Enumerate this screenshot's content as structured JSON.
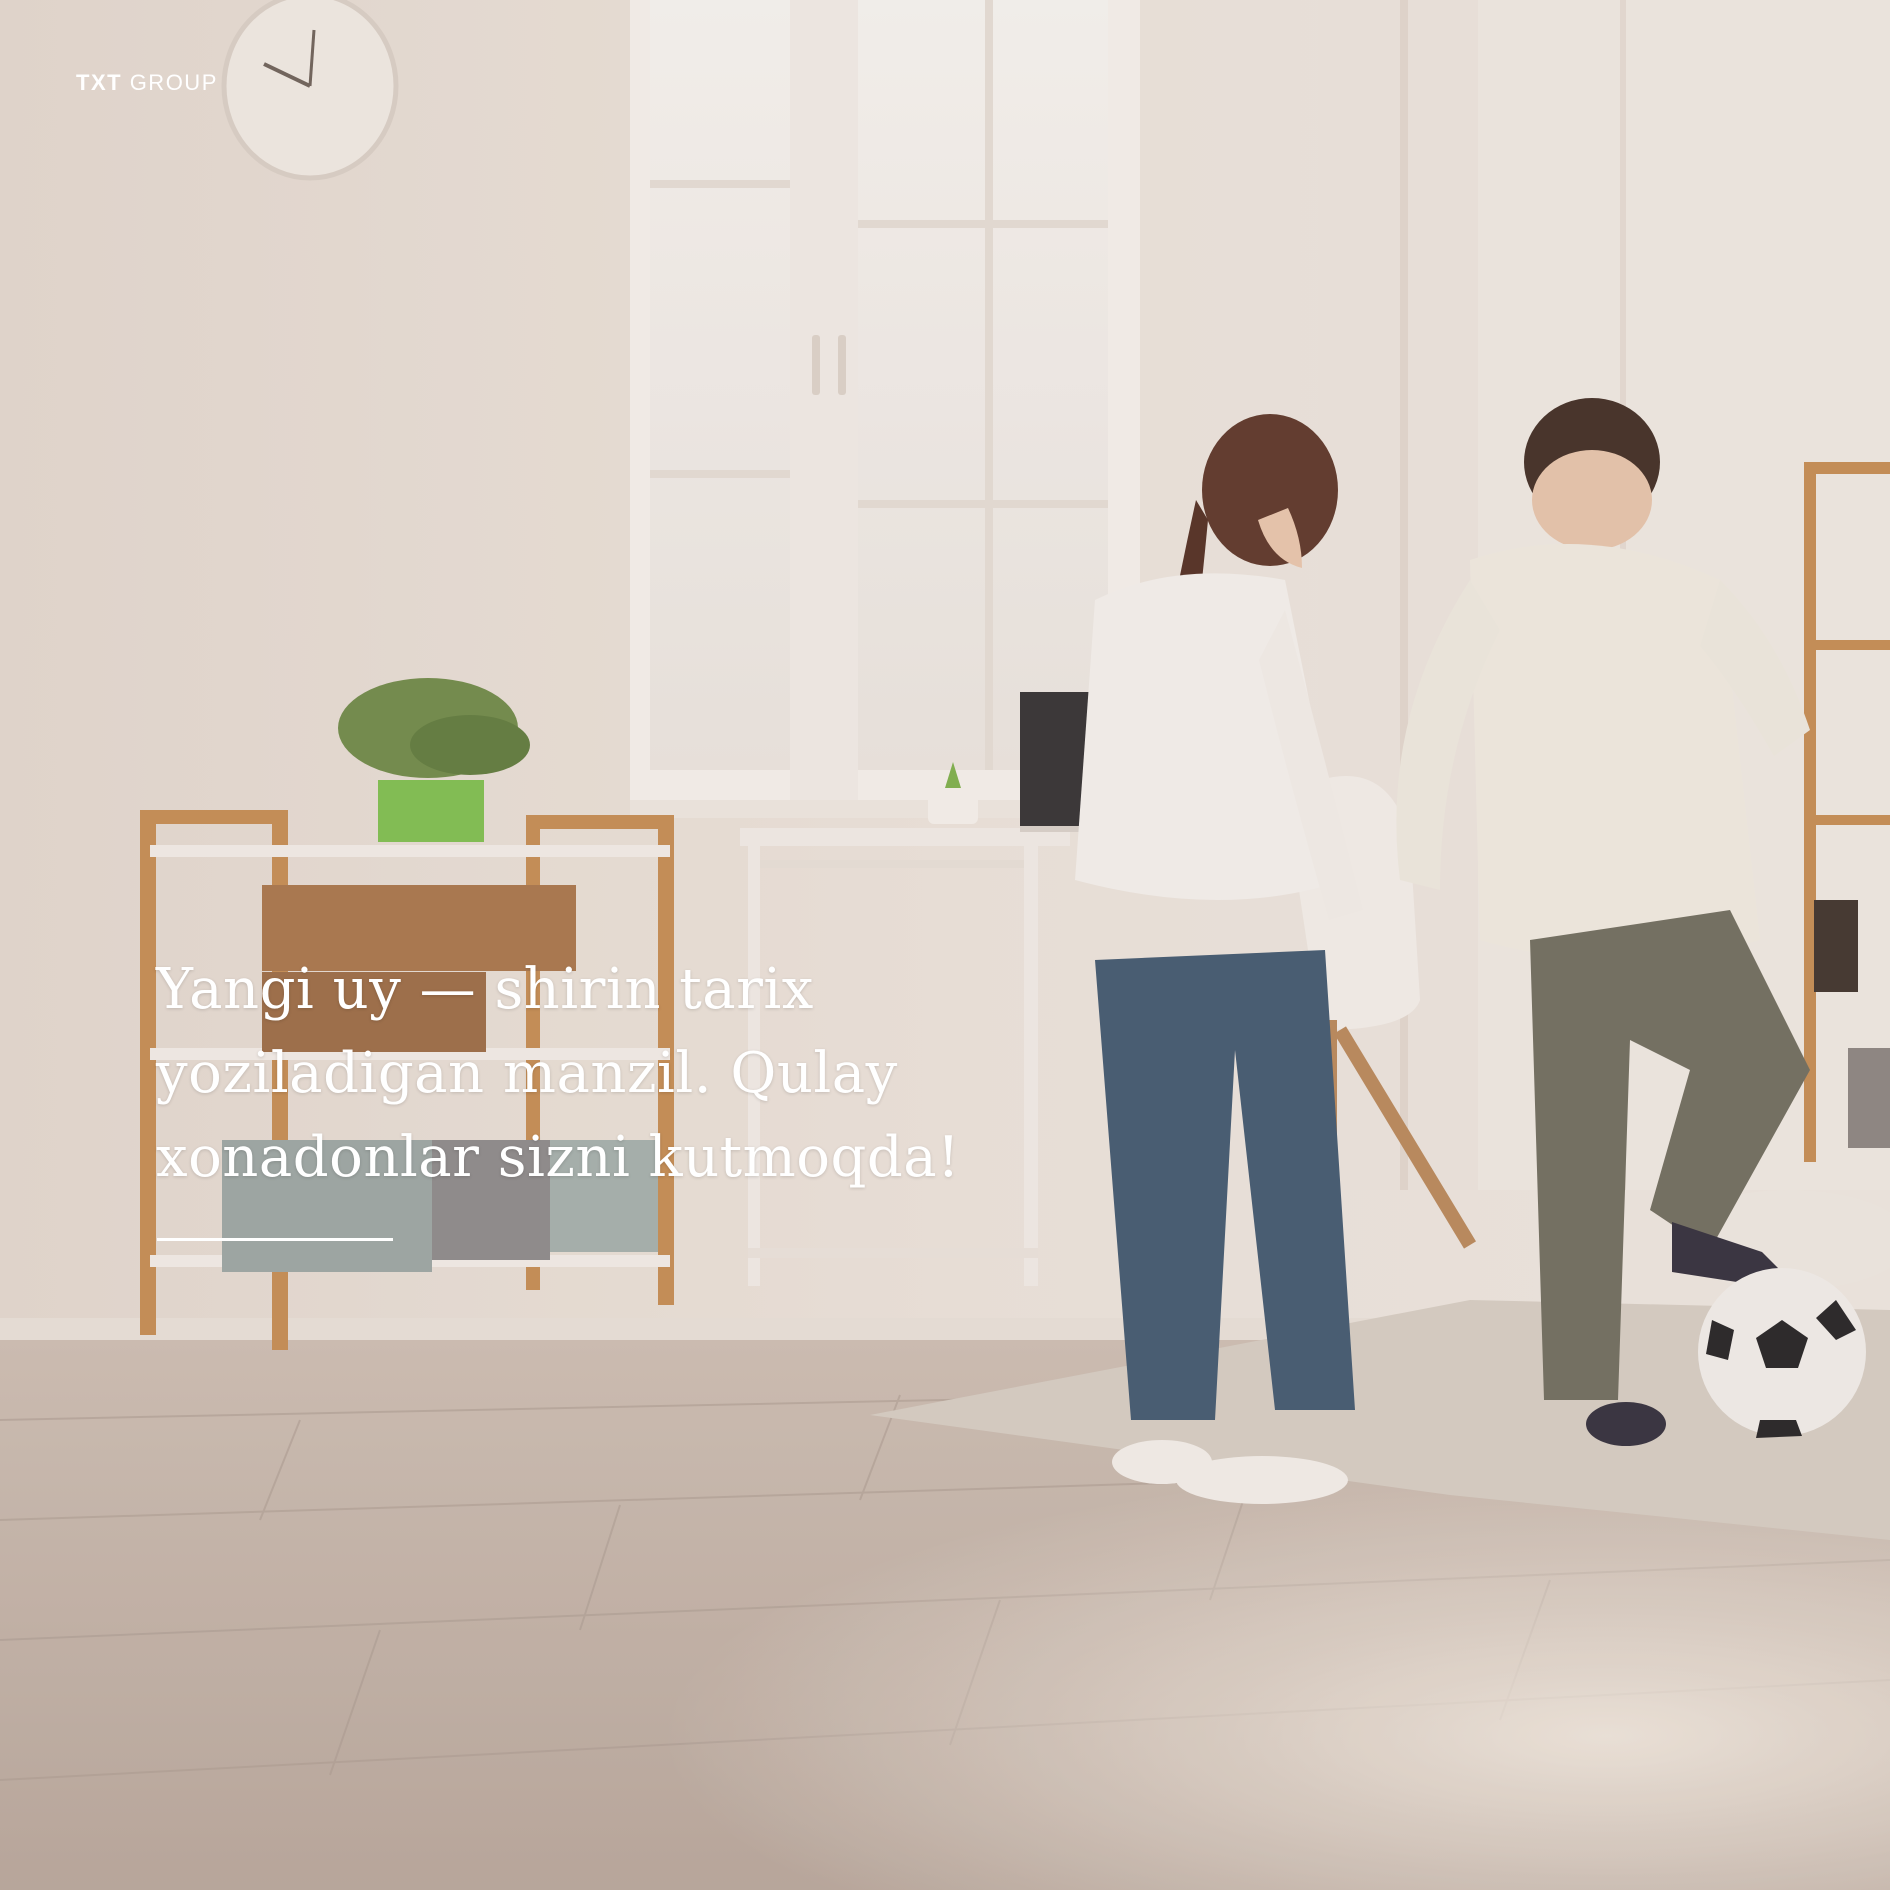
{
  "brand": {
    "bold": "TXT",
    "light": "GROUP"
  },
  "headline": {
    "line1": "Yangi uy — shirin tarix",
    "line2": "yoziladigan manzil. Qulay",
    "line3": "xonadonlar sizni kutmoqda!"
  }
}
